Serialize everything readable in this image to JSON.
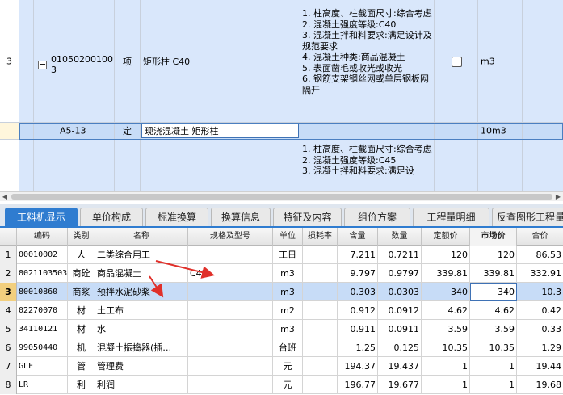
{
  "top_grid": {
    "rows": [
      {
        "number": "3",
        "code": "010502001003",
        "type": "项",
        "name": "矩形柱 C40",
        "description": "1. 柱高度、柱截面尺寸:综合考虑\n2. 混凝土强度等级:C40\n3. 混凝土拌和料要求:满足设计及规范要求\n4. 混凝土种类:商品混凝土\n5. 表面凿毛或收光或收光\n6. 钢筋支架钢丝网或单层钢板网隔开",
        "unit": "m3"
      },
      {
        "number": "",
        "code": "A5-13",
        "type": "定",
        "name": "现浇混凝土 矩形柱",
        "description": "",
        "unit": "10m3"
      },
      {
        "number": "",
        "code": "",
        "type": "",
        "name": "",
        "description": "1. 柱高度、柱截面尺寸:综合考虑\n2. 混凝土强度等级:C45\n3. 混凝土拌和料要求:满足设",
        "unit": ""
      }
    ]
  },
  "tabs": [
    {
      "label": "工料机显示",
      "active": true
    },
    {
      "label": "单价构成",
      "active": false
    },
    {
      "label": "标准换算",
      "active": false
    },
    {
      "label": "换算信息",
      "active": false
    },
    {
      "label": "特征及内容",
      "active": false
    },
    {
      "label": "组价方案",
      "active": false
    },
    {
      "label": "工程量明细",
      "active": false
    },
    {
      "label": "反查图形工程量",
      "active": false
    }
  ],
  "table": {
    "headers": {
      "code": "编码",
      "category": "类别",
      "name": "名称",
      "spec": "规格及型号",
      "unit": "单位",
      "loss": "损耗率",
      "content": "含量",
      "quantity": "数量",
      "quota_price": "定额价",
      "market_price": "市场价",
      "total": "合价"
    },
    "rows": [
      {
        "num": "1",
        "code": "00010002",
        "category": "人",
        "name": "二类综合用工",
        "spec": "",
        "unit": "工日",
        "loss": "",
        "content": "7.211",
        "quantity": "0.7211",
        "quota_price": "120",
        "market_price": "120",
        "total": "86.53"
      },
      {
        "num": "2",
        "code": "8021103503",
        "category": "商砼",
        "name": "商品混凝土",
        "spec": "C45",
        "unit": "m3",
        "loss": "",
        "content": "9.797",
        "quantity": "0.9797",
        "quota_price": "339.81",
        "market_price": "339.81",
        "total": "332.91"
      },
      {
        "num": "3",
        "code": "80010860",
        "category": "商浆",
        "name": "预拌水泥砂浆",
        "spec": "",
        "unit": "m3",
        "loss": "",
        "content": "0.303",
        "quantity": "0.0303",
        "quota_price": "340",
        "market_price": "340",
        "total": "10.3"
      },
      {
        "num": "4",
        "code": "02270070",
        "category": "材",
        "name": "土工布",
        "spec": "",
        "unit": "m2",
        "loss": "",
        "content": "0.912",
        "quantity": "0.0912",
        "quota_price": "4.62",
        "market_price": "4.62",
        "total": "0.42"
      },
      {
        "num": "5",
        "code": "34110121",
        "category": "材",
        "name": "水",
        "spec": "",
        "unit": "m3",
        "loss": "",
        "content": "0.911",
        "quantity": "0.0911",
        "quota_price": "3.59",
        "market_price": "3.59",
        "total": "0.33"
      },
      {
        "num": "6",
        "code": "99050440",
        "category": "机",
        "name": "混凝土振捣器(插…",
        "spec": "",
        "unit": "台班",
        "loss": "",
        "content": "1.25",
        "quantity": "0.125",
        "quota_price": "10.35",
        "market_price": "10.35",
        "total": "1.29"
      },
      {
        "num": "7",
        "code": "GLF",
        "category": "管",
        "name": "管理费",
        "spec": "",
        "unit": "元",
        "loss": "",
        "content": "194.37",
        "quantity": "19.437",
        "quota_price": "1",
        "market_price": "1",
        "total": "19.44"
      },
      {
        "num": "8",
        "code": "LR",
        "category": "利",
        "name": "利润",
        "spec": "",
        "unit": "元",
        "loss": "",
        "content": "196.77",
        "quantity": "19.677",
        "quota_price": "1",
        "market_price": "1",
        "total": "19.68"
      }
    ]
  },
  "colors": {
    "accent": "#2f7cd0",
    "row_bg": "#d9e7fb",
    "selected_row_bg": "#c7dcf7",
    "annotation_arrow": "#e0302a"
  }
}
